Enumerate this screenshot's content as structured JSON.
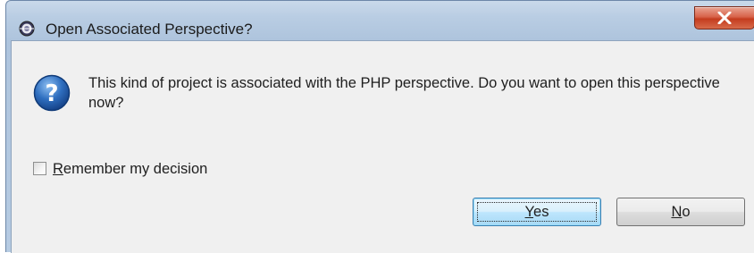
{
  "window": {
    "title": "Open Associated Perspective?"
  },
  "dialog": {
    "message": "This kind of project is associated with the PHP perspective.  Do you want to open this perspective now?",
    "remember_checkbox": {
      "mnemonic": "R",
      "label_rest": "emember my decision",
      "checked": false
    },
    "buttons": {
      "yes": {
        "mnemonic": "Y",
        "label_rest": "es",
        "default": true
      },
      "no": {
        "mnemonic": "N",
        "label_rest": "o"
      }
    },
    "icon": "question-icon"
  },
  "colors": {
    "titlebar": "#b9cde3",
    "client_background": "#f0f0f0",
    "close_button": "#c43c1f",
    "question_icon": "#1f5fa8"
  }
}
